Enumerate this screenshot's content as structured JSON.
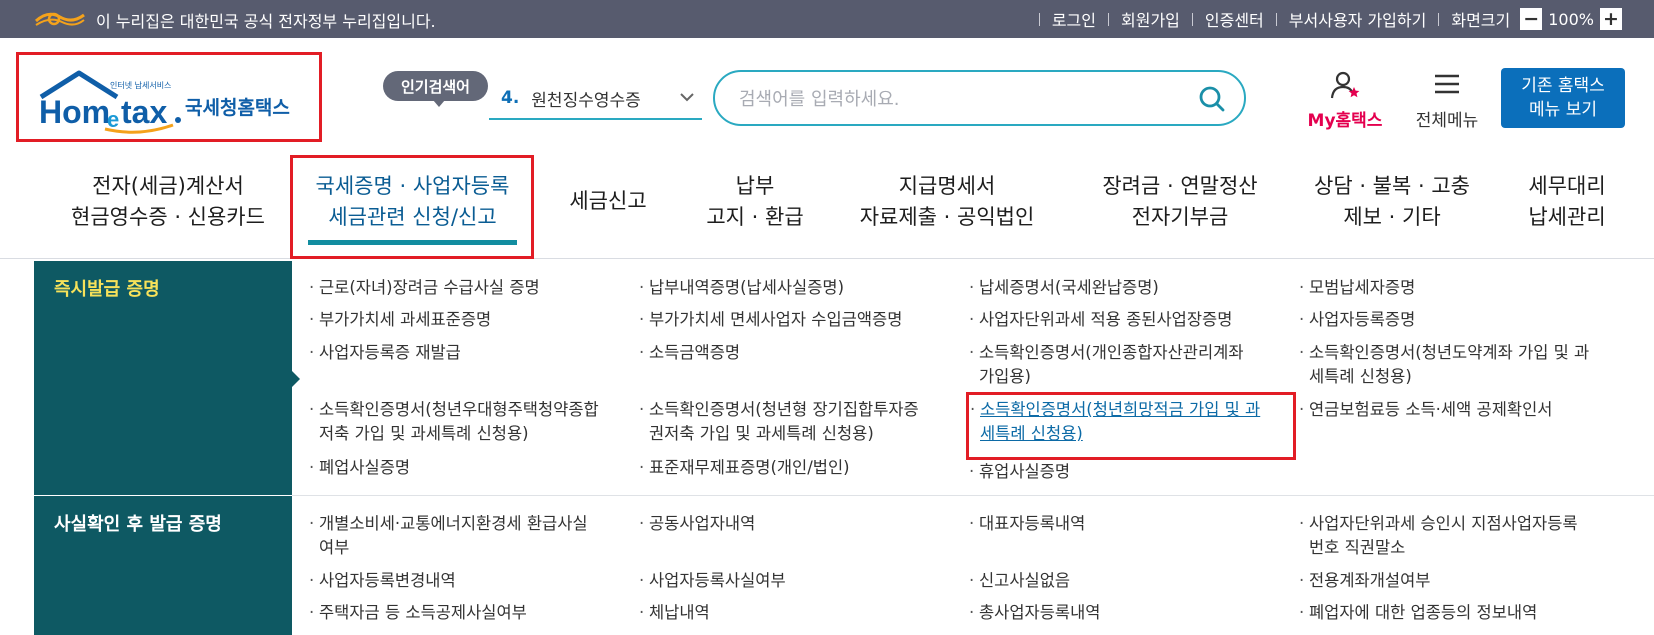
{
  "top_bar": {
    "gov_notice": "이 누리집은 대한민국 공식 전자정부 누리집입니다.",
    "links": [
      "로그인",
      "회원가입",
      "인증센터",
      "부서사용자 가입하기",
      "화면크기"
    ],
    "zoom_minus": "−",
    "zoom_level": "100%",
    "zoom_plus": "+"
  },
  "logo": {
    "small_text": "인터넷 납세서비스",
    "title": "국세청홈택스"
  },
  "search": {
    "popular_badge": "인기검색어",
    "popular_rank": "4.",
    "popular_term": "원천징수영수증",
    "placeholder": "검색어를 입력하세요."
  },
  "header_actions": {
    "my_hometax": "My홈택스",
    "all_menu": "전체메뉴",
    "legacy_line1": "기존 홈택스",
    "legacy_line2": "메뉴 보기"
  },
  "nav": [
    {
      "line1": "전자(세금)계산서",
      "line2": "현금영수증 · 신용카드"
    },
    {
      "line1": "국세증명 · 사업자등록",
      "line2": "세금관련 신청/신고"
    },
    {
      "line1": "세금신고",
      "line2": ""
    },
    {
      "line1": "납부",
      "line2": "고지 · 환급"
    },
    {
      "line1": "지급명세서",
      "line2": "자료제출 · 공익법인"
    },
    {
      "line1": "장려금 · 연말정산",
      "line2": "전자기부금"
    },
    {
      "line1": "상담 · 불복 · 고충",
      "line2": "제보 · 기타"
    },
    {
      "line1": "세무대리",
      "line2": "납세관리"
    }
  ],
  "sections": [
    {
      "title": "즉시발급 증명",
      "links": [
        [
          "근로(자녀)장려금 수급사실 증명"
        ],
        [
          "납부내역증명(납세사실증명)"
        ],
        [
          "납세증명서(국세완납증명)"
        ],
        [
          "모범납세자증명"
        ],
        [
          "부가가치세 과세표준증명"
        ],
        [
          "부가가치세 면세사업자 수입금액증명"
        ],
        [
          "사업자단위과세 적용 종된사업장증명"
        ],
        [
          "사업자등록증명"
        ],
        [
          "사업자등록증 재발급"
        ],
        [
          "소득금액증명"
        ],
        [
          "소득확인증명서(개인종합자산관리계좌",
          "가입용)"
        ],
        [
          "소득확인증명서(청년도약계좌 가입 및 과",
          "세특례 신청용)"
        ],
        [
          "소득확인증명서(청년우대형주택청약종합",
          "저축 가입 및 과세특례 신청용)"
        ],
        [
          "소득확인증명서(청년형 장기집합투자증",
          "권저축 가입 및 과세특례 신청용)"
        ],
        [
          "소득확인증명서(청년희망적금 가입 및 과",
          "세특례 신청용)"
        ],
        [
          "연금보험료등 소득·세액 공제확인서"
        ],
        [
          "폐업사실증명"
        ],
        [
          "표준재무제표증명(개인/법인)"
        ],
        [
          "휴업사실증명"
        ]
      ]
    },
    {
      "title": "사실확인 후 발급 증명",
      "links": [
        [
          "개별소비세·교통에너지환경세 환급사실",
          "여부"
        ],
        [
          "공동사업자내역"
        ],
        [
          "대표자등록내역"
        ],
        [
          "사업자단위과세 승인시 지점사업자등록",
          "번호 직권말소"
        ],
        [
          "사업자등록변경내역"
        ],
        [
          "사업자등록사실여부"
        ],
        [
          "신고사실없음"
        ],
        [
          "전용계좌개설여부"
        ],
        [
          "주택자금 등 소득공제사실여부"
        ],
        [
          "체납내역"
        ],
        [
          "총사업자등록내역"
        ],
        [
          "폐업자에 대한 업종등의 정보내역"
        ]
      ]
    }
  ],
  "colors": {
    "top_bar": "#575b6e",
    "brand_blue": "#0b6fbb",
    "side_panel": "#0e5963",
    "side_title_yellow": "#f7e25a",
    "accent_teal": "#2aa9c1",
    "highlight_red": "#e21d25",
    "my_home_pink": "#e4004f"
  }
}
